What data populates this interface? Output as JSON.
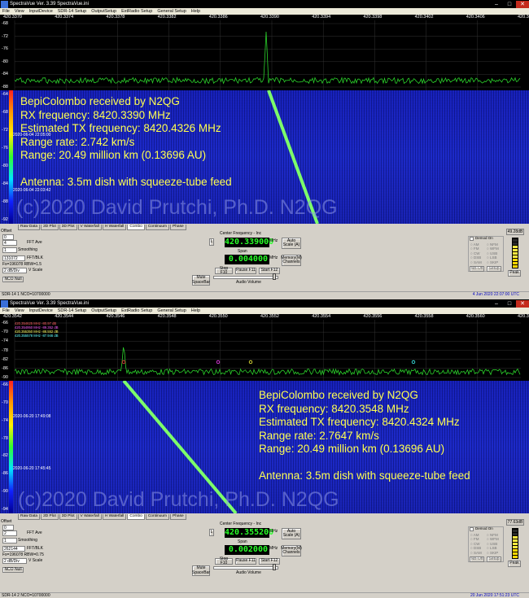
{
  "window1": {
    "title": "SpectraVue Ver. 3.39 SpectraVue.ini",
    "menu": [
      "File",
      "View",
      "InputDevice",
      "SDR-14 Setup",
      "OutputSetup",
      "ExtRadio Setup",
      "General Setup",
      "Help"
    ],
    "freq_ticks": [
      "420.3370",
      "420.3374",
      "420.3378",
      "420.3382",
      "420.3386",
      "420.3390",
      "420.3394",
      "420.3398",
      "420.3402",
      "420.3406",
      "420.3410"
    ],
    "db_ticks": [
      "-68",
      "-72",
      "-76",
      "-80",
      "-84",
      "-88"
    ],
    "wf_db_ticks": [
      "-64",
      "-68",
      "-72",
      "-76",
      "-80",
      "-84",
      "-88",
      "-92"
    ],
    "annotation": "BepiColombo received by N2QG\nRX frequency: 8420.3390 MHz\nEstimated TX frequency: 8420.4326 MHz\nRange rate: 2.742 km/s\nRange: 20.49 million km (0.13696 AU)\n\nAntenna: 3.5m dish with squeeze-tube feed",
    "copyright": "(c)2020 David Prutchi, Ph.D.  N2QG",
    "wf_dates": [
      "2020-06-04 22:05:00",
      "2020-06-04 22:03:42"
    ],
    "tabs": [
      "Raw Data",
      "2D Plot",
      "3D Plot",
      "V Waterfall",
      "H Waterfall",
      "Combo",
      "Continuum",
      "Phase"
    ],
    "offset_label": "Offset",
    "offset_val": "0",
    "fft_ave_val": "4",
    "fft_ave_label": "FFT Ave",
    "smoothing_val": "1",
    "smoothing_label": "Smoothing",
    "fft_val": "131072",
    "fft_label": "FFT/BLK",
    "fs_label": "Fs=196078 RBW=1.5",
    "vscale_val": "2 dB/Div",
    "vscale_label": "V Scale",
    "nco_null": "NCO Null",
    "center_label": "Center Frequency - Inc",
    "center_freq": "420.339000",
    "center_unit": "MHz",
    "l_label": "L",
    "autoscale": "Auto Scale (A)",
    "span_label": "Span",
    "span_val": "0.004000",
    "span_unit": "MHz",
    "memory": "Memory(M) Channels",
    "stop": "Stop F10",
    "pause": "Pause F11",
    "start": "Start F12",
    "mute": "Mute SpaceBar",
    "audio_vol": "Audio Volume",
    "demod_title": "Demod On",
    "demod_modes": [
      "AM",
      "FM",
      "CW",
      "DSB",
      "SAM",
      "NFM",
      "WFM",
      "USB",
      "LSB",
      "SKIP"
    ],
    "nb_off": "NB Off",
    "setup": "Setup",
    "peak_db": "49.28dB",
    "peak_label": "Peak",
    "status_left": "SDR-14 1  NCO=10700000",
    "status_right": "4 Jun 2020  22:07:00 UTC"
  },
  "window2": {
    "title": "SpectraVue Ver. 3.39 SpectraVue.ini",
    "menu": [
      "File",
      "View",
      "InputDevice",
      "SDR-14 Setup",
      "OutputSetup",
      "ExtRadio Setup",
      "General Setup",
      "Help"
    ],
    "freq_ticks": [
      "420.3542",
      "420.3544",
      "420.3546",
      "420.3548",
      "420.3550",
      "420.3552",
      "420.3554",
      "420.3556",
      "420.3558",
      "420.3560",
      "420.3562"
    ],
    "db_ticks": [
      "-66",
      "-70",
      "-74",
      "-78",
      "-82",
      "-86",
      "-90"
    ],
    "wf_db_ticks": [
      "-66",
      "-70",
      "-74",
      "-78",
      "-82",
      "-86",
      "-90",
      "-94"
    ],
    "markers": [
      "420.354625 MHz  -80.97 dB",
      "420.354950 MHz  -89.352 dB",
      "420.355350 MHz  -88.552 dB",
      "420.355578 MHz  -87.946 dB"
    ],
    "annotation": "BepiColombo received by N2QG\nRX frequency: 8420.3548 MHz\nEstimated TX frequency: 8420.4324 MHz\nRange rate: 2.7647 km/s\nRange: 20.49 million km (0.13696 AU)\n\nAntenna: 3.5m dish with squeeze-tube feed",
    "copyright": "(c)2020 David Prutchi, Ph.D.  N2QG",
    "wf_dates": [
      "2020-06-20 17:49:08",
      "2020-06-20 17:45:45"
    ],
    "tabs": [
      "Raw Data",
      "2D Plot",
      "3D Plot",
      "V Waterfall",
      "H Waterfall",
      "Combo",
      "Continuum",
      "Phase"
    ],
    "offset_label": "Offset",
    "offset_val": "0",
    "fft_ave_val": "2",
    "fft_ave_label": "FFT Ave",
    "smoothing_val": "1",
    "smoothing_label": "Smoothing",
    "fft_val": "262144",
    "fft_label": "FFT/BLK",
    "fs_label": "Fs=196078 RBW=0.75",
    "vscale_val": "2 dB/Div",
    "vscale_label": "V Scale",
    "nco_null": "NCO Null",
    "center_label": "Center Frequency - Inc",
    "center_freq": "420.355200",
    "center_unit": "MHz",
    "l_label": "L",
    "autoscale": "Auto Scale (A)",
    "span_label": "Span",
    "span_val": "0.002000",
    "span_unit": "MHz",
    "memory": "Memory(M) Channels",
    "stop": "Stop F10",
    "pause": "Pause F11",
    "start": "Start F12",
    "mute": "Mute SpaceBar",
    "audio_vol": "Audio Volume",
    "demod_title": "Demod On",
    "demod_modes": [
      "AM",
      "FM",
      "CW",
      "DSB",
      "SAM",
      "NFM",
      "WFM",
      "USB",
      "LSB",
      "SKIP"
    ],
    "nb_off": "NB Off",
    "setup": "Setup",
    "peak_db": "77.63dB",
    "peak_label": "Peak",
    "status_left": "SDR-14 2  NCO=10700000",
    "status_right": "20 Jun 2020  17:51:23 UTC"
  },
  "colors": {
    "trace": "#2bd12b",
    "waterfall": "#1a28c0",
    "signal": "#7dff6a",
    "annotation": "#ffff50",
    "lcd": "#28ff28"
  }
}
